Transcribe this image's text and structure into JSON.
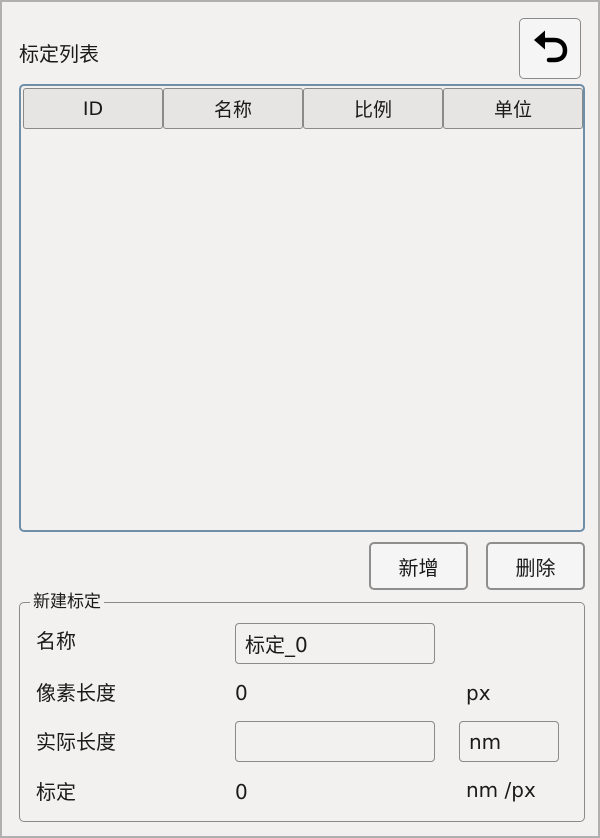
{
  "header": {
    "title": "标定列表",
    "back_icon": "undo-arrow-icon"
  },
  "table": {
    "columns": [
      "ID",
      "名称",
      "比例",
      "单位"
    ],
    "rows": []
  },
  "actions": {
    "add_label": "新增",
    "delete_label": "删除"
  },
  "new_calibration": {
    "legend": "新建标定",
    "name_label": "名称",
    "name_value": "标定_0",
    "pixel_length_label": "像素长度",
    "pixel_length_value": "0",
    "pixel_unit": "px",
    "actual_length_label": "实际长度",
    "actual_length_value": "",
    "actual_unit_value": "nm",
    "calibration_label": "标定",
    "calibration_value": "0",
    "calibration_unit": "nm /px"
  },
  "colors": {
    "background": "#f2f1ef",
    "table_border": "#6f8ea8",
    "button_border": "#8e8e8e"
  }
}
